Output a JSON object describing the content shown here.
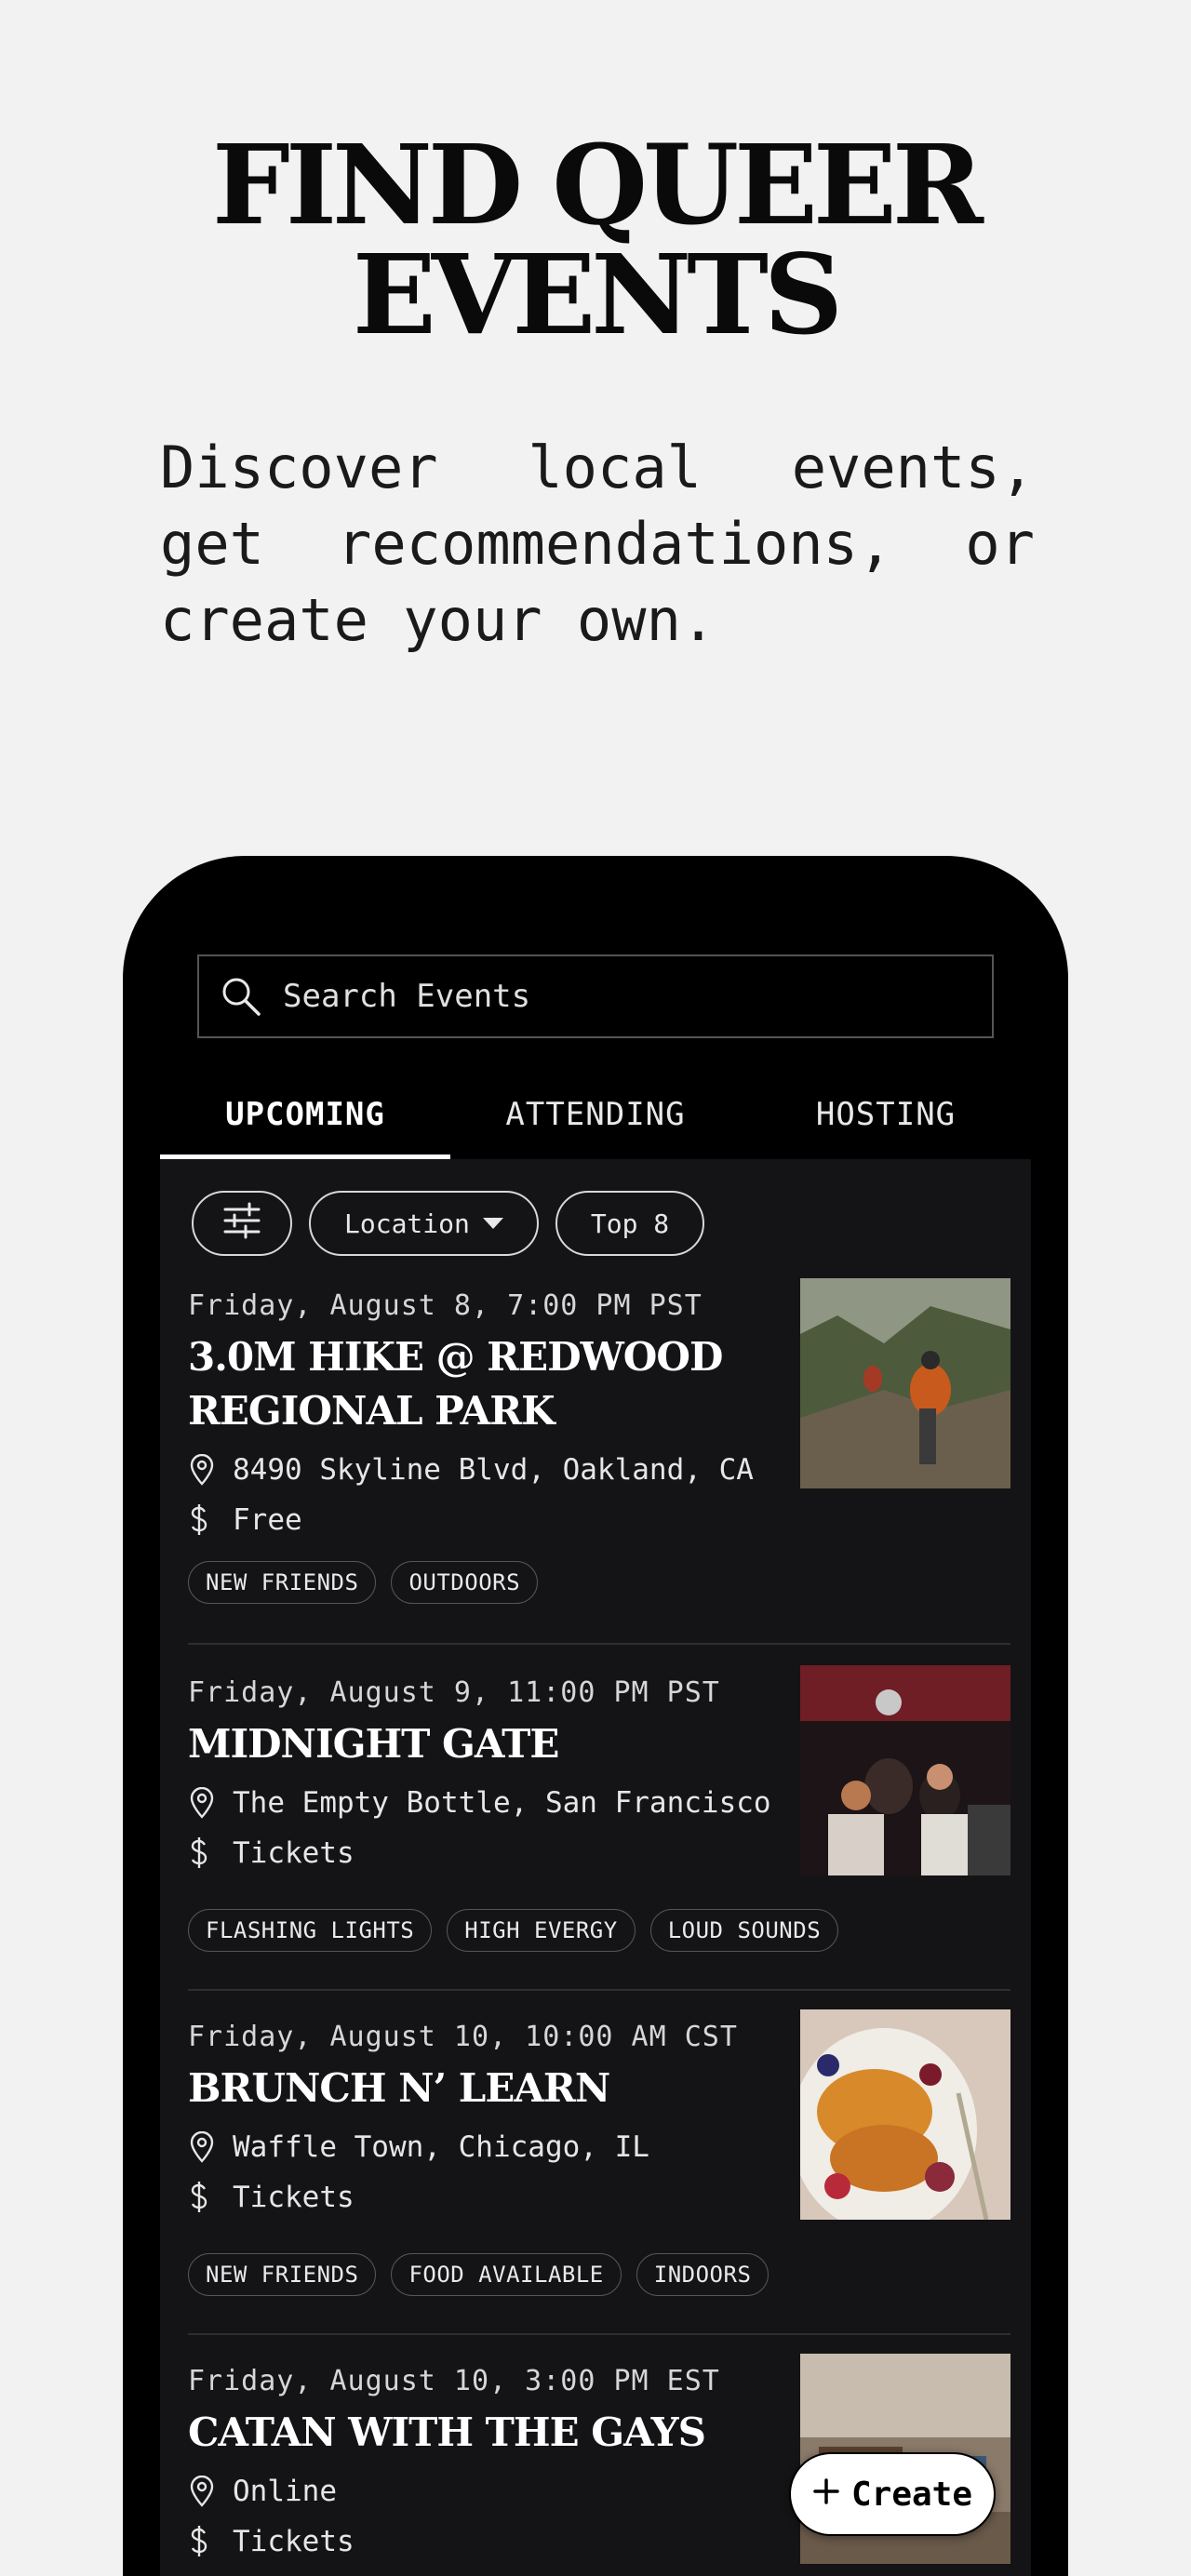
{
  "hero": {
    "title_line1": "FIND QUEER",
    "title_line2": "EVENTS",
    "subtitle": "Discover local events, get recommendations, or create your own."
  },
  "search": {
    "placeholder": "Search Events",
    "icon": "search-icon"
  },
  "tabs": [
    {
      "label": "UPCOMING",
      "active": true
    },
    {
      "label": "ATTENDING",
      "active": false
    },
    {
      "label": "HOSTING",
      "active": false
    }
  ],
  "filters": {
    "filter_icon": "sliders-icon",
    "location_label": "Location",
    "top_label": "Top 8"
  },
  "events": [
    {
      "date": "Friday, August 8, 7:00 PM PST",
      "title": "3.0M HIKE @ REDWOOD REGIONAL PARK",
      "location": "8490 Skyline Blvd, Oakland, CA",
      "price": "Free",
      "tags": [
        "NEW FRIENDS",
        "OUTDOORS"
      ]
    },
    {
      "date": "Friday, August 9, 11:00 PM PST",
      "title": "MIDNIGHT GATE",
      "location": "The Empty Bottle, San Francisco",
      "price": "Tickets",
      "tags": [
        "FLASHING LIGHTS",
        "HIGH EVERGY",
        "LOUD SOUNDS"
      ]
    },
    {
      "date": "Friday, August 10, 10:00 AM CST",
      "title": "BRUNCH N’ LEARN",
      "location": "Waffle Town, Chicago, IL",
      "price": "Tickets",
      "tags": [
        "NEW FRIENDS",
        "FOOD AVAILABLE",
        "INDOORS"
      ]
    },
    {
      "date": "Friday, August 10, 3:00 PM EST",
      "title": "CATAN WITH THE GAYS",
      "location": "Online",
      "price": "Tickets",
      "tags": []
    }
  ],
  "create_button": {
    "label": "Create",
    "icon": "plus-icon"
  },
  "colors": {
    "page_bg": "#f2f2f2",
    "phone_bg": "#000000",
    "list_bg": "#141416",
    "text_light": "#ffffff"
  }
}
